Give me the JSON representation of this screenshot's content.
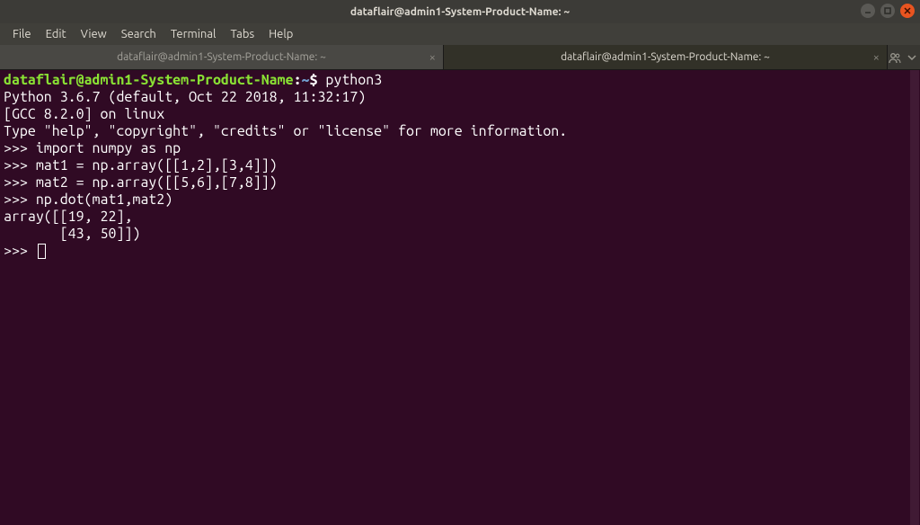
{
  "window": {
    "title": "dataflair@admin1-System-Product-Name: ~"
  },
  "menu": {
    "file": "File",
    "edit": "Edit",
    "view": "View",
    "search": "Search",
    "terminal": "Terminal",
    "tabs": "Tabs",
    "help": "Help"
  },
  "tabs": {
    "tab1": "dataflair@admin1-System-Product-Name: ~",
    "tab2": "dataflair@admin1-System-Product-Name: ~"
  },
  "prompt": {
    "user_host": "dataflair@admin1-System-Product-Name",
    "sep": ":",
    "path": "~",
    "dollar": "$"
  },
  "cmd": {
    "python3": " python3"
  },
  "output": {
    "l1": "Python 3.6.7 (default, Oct 22 2018, 11:32:17) ",
    "l2": "[GCC 8.2.0] on linux",
    "l3": "Type \"help\", \"copyright\", \"credits\" or \"license\" for more information.",
    "p1": ">>> import numpy as np",
    "p2": ">>> mat1 = np.array([[1,2],[3,4]])",
    "p3": ">>> mat2 = np.array([[5,6],[7,8]])",
    "p4": ">>> np.dot(mat1,mat2)",
    "r1": "array([[19, 22],",
    "r2": "       [43, 50]])",
    "p5": ">>> "
  }
}
